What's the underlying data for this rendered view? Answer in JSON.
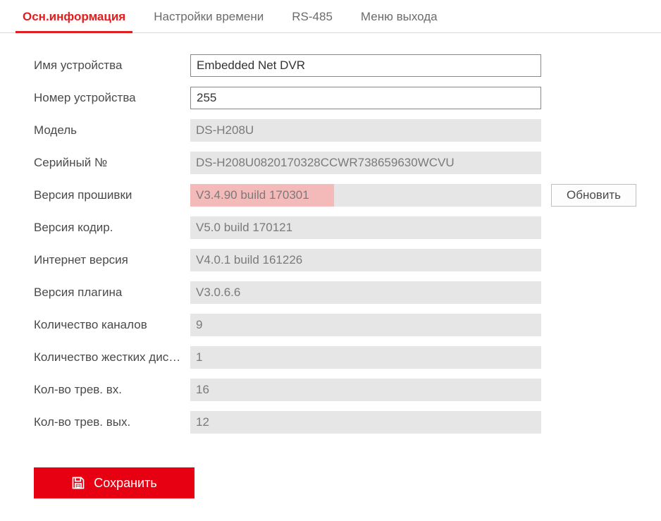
{
  "tabs": {
    "basic_info": "Осн.информация",
    "time_settings": "Настройки времени",
    "rs485": "RS-485",
    "exit_menu": "Меню выхода"
  },
  "fields": {
    "device_name": {
      "label": "Имя устройства",
      "value": "Embedded Net DVR"
    },
    "device_number": {
      "label": "Номер устройства",
      "value": "255"
    },
    "model": {
      "label": "Модель",
      "value": "DS-H208U"
    },
    "serial": {
      "label": "Серийный №",
      "value": "DS-H208U0820170328CCWR738659630WCVU"
    },
    "firmware": {
      "label": "Версия прошивки",
      "value": "V3.4.90 build 170301"
    },
    "encoding": {
      "label": "Версия кодир.",
      "value": "V5.0 build 170121"
    },
    "internet": {
      "label": "Интернет версия",
      "value": "V4.0.1 build 161226"
    },
    "plugin": {
      "label": "Версия плагина",
      "value": "V3.0.6.6"
    },
    "channels": {
      "label": "Количество каналов",
      "value": "9"
    },
    "hdds": {
      "label": "Количество жестких дис…",
      "value": "1"
    },
    "alarm_in": {
      "label": "Кол-во трев. вх.",
      "value": "16"
    },
    "alarm_out": {
      "label": "Кол-во трев. вых.",
      "value": "12"
    }
  },
  "buttons": {
    "update": "Обновить",
    "save": "Сохранить"
  }
}
